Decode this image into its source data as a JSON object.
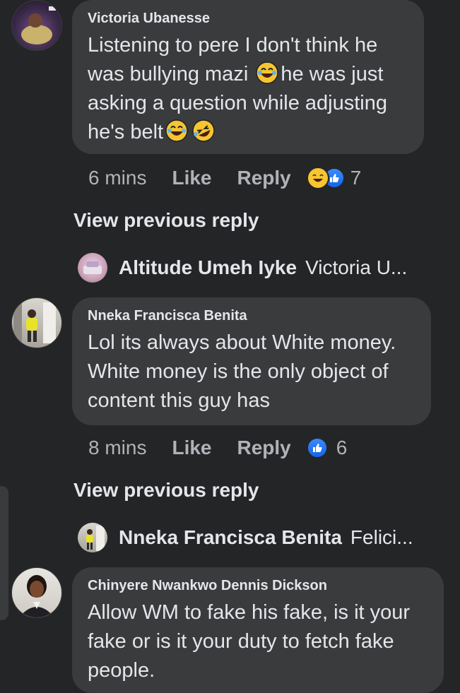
{
  "comments": [
    {
      "author": "Victoria Ubanesse",
      "text_line1": "Listening to pere I don't think he",
      "text_line2a": "was bullying mazi",
      "text_line2b": "he was just",
      "text_line3": "asking a question while adjusting",
      "text_line4": "he's belt",
      "time": "6 mins",
      "like_label": "Like",
      "reply_label": "Reply",
      "reaction_count": "7",
      "reactions": [
        "haha-icon",
        "like-icon"
      ]
    },
    {
      "author": "Nneka Francisca Benita",
      "text_line1": "Lol its always about White money.",
      "text_line2": "White money is the only object of",
      "text_line3": "content this guy has",
      "time": "8 mins",
      "like_label": "Like",
      "reply_label": "Reply",
      "reaction_count": "6",
      "reactions": [
        "like-icon"
      ]
    },
    {
      "author": "Chinyere Nwankwo Dennis Dickson",
      "text_line1": "Allow WM to fake his fake, is it your",
      "text_line2": "fake or is it your duty to fetch fake",
      "text_line3": "people."
    }
  ],
  "threads": [
    {
      "view_previous": "View previous reply",
      "reply_author": "Altitude Umeh Iyke",
      "reply_preview": "Victoria U..."
    },
    {
      "view_previous": "View previous reply",
      "reply_author": "Nneka Francisca Benita",
      "reply_preview": "Felici..."
    }
  ],
  "colors": {
    "background": "#242526",
    "bubble": "#3a3b3c",
    "text": "#e4e6eb",
    "secondary": "#b0b3b8",
    "like_blue": "#1877f2",
    "haha_yellow": "#f7c531"
  }
}
